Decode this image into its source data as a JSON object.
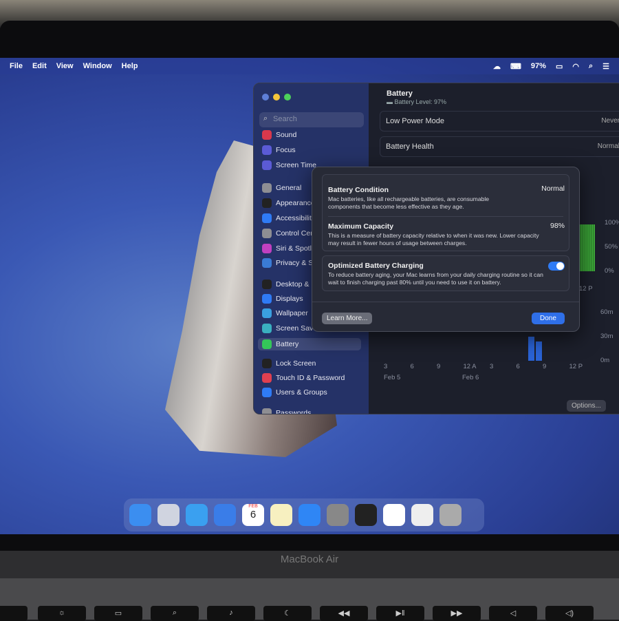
{
  "menubar": {
    "items": [
      "File",
      "Edit",
      "View",
      "Window",
      "Help"
    ],
    "battery": "97%"
  },
  "sidebar": {
    "search_placeholder": "Search",
    "items": [
      {
        "label": "Sound",
        "color": "#d8384c"
      },
      {
        "label": "Focus",
        "color": "#5b5bd6"
      },
      {
        "label": "Screen Time",
        "color": "#5b5bd6"
      },
      {
        "label": "General",
        "color": "#8e8e93"
      },
      {
        "label": "Appearance",
        "color": "#222"
      },
      {
        "label": "Accessibility",
        "color": "#2f7bf5"
      },
      {
        "label": "Control Center",
        "color": "#8e8e93"
      },
      {
        "label": "Siri & Spotlight",
        "color": "#c040c0"
      },
      {
        "label": "Privacy & Security",
        "color": "#3a7bd5"
      },
      {
        "label": "Desktop & Dock",
        "color": "#222"
      },
      {
        "label": "Displays",
        "color": "#2f7bf5"
      },
      {
        "label": "Wallpaper",
        "color": "#3aa0e0"
      },
      {
        "label": "Screen Saver",
        "color": "#3ab0c0"
      },
      {
        "label": "Battery",
        "color": "#34c759"
      },
      {
        "label": "Lock Screen",
        "color": "#222"
      },
      {
        "label": "Touch ID & Password",
        "color": "#e04050"
      },
      {
        "label": "Users & Groups",
        "color": "#2f7bf5"
      },
      {
        "label": "Passwords",
        "color": "#8e8e93"
      }
    ],
    "selected": "Battery"
  },
  "main": {
    "title": "Battery",
    "subtitle": "Battery Level: 97%",
    "rows": [
      {
        "label": "Low Power Mode",
        "value": "Never"
      },
      {
        "label": "Battery Health",
        "value": "Normal"
      }
    ],
    "options_button": "Options...",
    "help_button": "?"
  },
  "chart_data": [
    {
      "type": "bar",
      "ylabels": [
        "100%",
        "50%",
        "0%"
      ],
      "xlabels": [
        "12 P"
      ],
      "color": "#34c759"
    },
    {
      "type": "bar",
      "ylabels": [
        "60m",
        "30m",
        "0m"
      ],
      "xlabels": [
        "3",
        "6",
        "9",
        "12 A",
        "3",
        "6",
        "9",
        "12 P"
      ],
      "date_labels": [
        "Feb 5",
        "Feb 6"
      ],
      "values_minutes": [
        0,
        0,
        0,
        0,
        0,
        0,
        0,
        0,
        0,
        0,
        0,
        0,
        0,
        0,
        0,
        0,
        0,
        0,
        30,
        24,
        0,
        0,
        0,
        0
      ],
      "color": "#2a63d6"
    }
  ],
  "sheet": {
    "condition": {
      "title": "Battery Condition",
      "value": "Normal",
      "desc": "Mac batteries, like all rechargeable batteries, are consumable components that become less effective as they age."
    },
    "capacity": {
      "title": "Maximum Capacity",
      "value": "98%",
      "desc": "This is a measure of battery capacity relative to when it was new. Lower capacity may result in fewer hours of usage between charges."
    },
    "optimized": {
      "title": "Optimized Battery Charging",
      "enabled": true,
      "desc": "To reduce battery aging, your Mac learns from your daily charging routine so it can wait to finish charging past 80% until you need to use it on battery."
    },
    "learn_more": "Learn More...",
    "done": "Done"
  },
  "dock": [
    "Finder",
    "Launchpad",
    "Safari",
    "Mail",
    "Calendar",
    "Notes",
    "App Store",
    "System Settings",
    "Go",
    "Word",
    "Document",
    "Trash"
  ],
  "calendar": {
    "month": "FEB",
    "day": "6"
  },
  "device": "MacBook Air"
}
